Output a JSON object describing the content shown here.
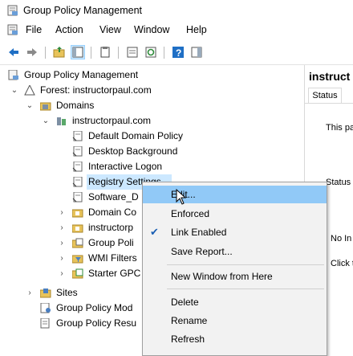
{
  "window": {
    "title": "Group Policy Management"
  },
  "menu": [
    "File",
    "Action",
    "View",
    "Window",
    "Help"
  ],
  "toolbar": [
    "back-icon",
    "forward-icon",
    "up-folder-icon",
    "show-hide-tree-icon",
    "properties-icon",
    "export-list-icon",
    "refresh-icon",
    "help-icon",
    "action-pane-icon"
  ],
  "tree": {
    "root": "Group Policy Management",
    "forest": "Forest: instructorpaul.com",
    "domains": "Domains",
    "domain": "instructorpaul.com",
    "gpos": [
      "Default Domain Policy",
      "Desktop Background",
      "Interactive Logon",
      "Registry Settings",
      "Software_D"
    ],
    "domain_children": [
      "Domain Co",
      "instructorp",
      "Group Poli",
      "WMI Filters",
      "Starter GPC"
    ],
    "sites": "Sites",
    "modeling": "Group Policy Mod",
    "results": "Group Policy Resu"
  },
  "right_pane": {
    "title": "instruct",
    "tab": "Status",
    "text1": "This pa",
    "text2": "Status",
    "text3": "No In",
    "text4": "Click t"
  },
  "context_menu": {
    "items": [
      "Edit...",
      "Enforced",
      "Link Enabled",
      "Save Report...",
      "New Window from Here",
      "Delete",
      "Rename",
      "Refresh"
    ],
    "checked": "Link Enabled",
    "highlighted": "Edit..."
  },
  "colors": {
    "selection": "#cce8ff",
    "menu_highlight": "#91c9f7",
    "menu_bg": "#f2f2f2"
  }
}
